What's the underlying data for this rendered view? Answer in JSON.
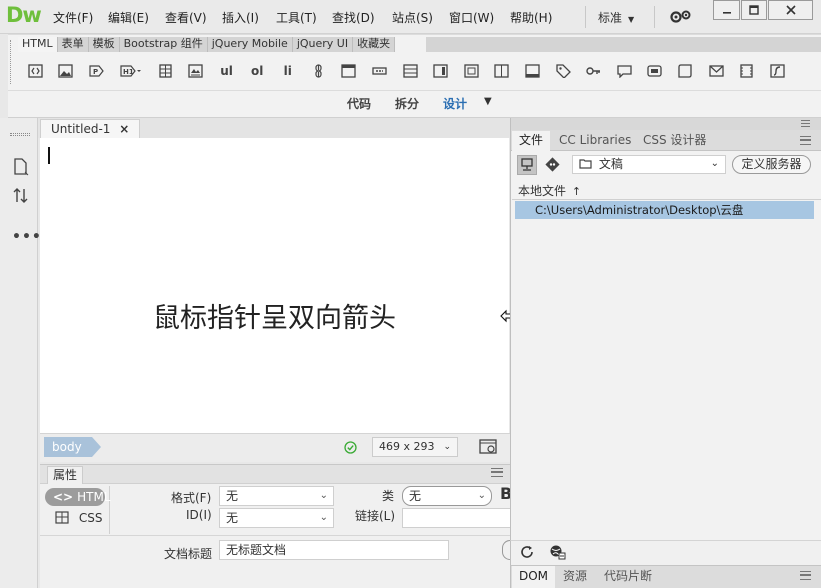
{
  "app": {
    "logo": "Dw",
    "menus": [
      "文件(F)",
      "编辑(E)",
      "查看(V)",
      "插入(I)",
      "工具(T)",
      "查找(D)",
      "站点(S)",
      "窗口(W)",
      "帮助(H)"
    ],
    "workspace": "标准",
    "window_buttons": [
      "minimize",
      "maximize",
      "close"
    ]
  },
  "insert_panel": {
    "tabs": [
      "HTML",
      "表单",
      "模板",
      "Bootstrap 组件",
      "jQuery Mobile",
      "jQuery UI",
      "收藏夹"
    ],
    "active_tab": "HTML",
    "text_buttons": {
      "ul": "ul",
      "ol": "ol",
      "li": "li"
    }
  },
  "view_modes": {
    "code": "代码",
    "split": "拆分",
    "design": "设计",
    "active": "设计"
  },
  "document": {
    "tab_title": "Untitled-1",
    "tab_close": "×",
    "overlay_caption": "鼠标指针呈双向箭头"
  },
  "status_bar": {
    "tag": "body",
    "size": "469 x 293"
  },
  "properties": {
    "title": "属性",
    "html_button": "HTML",
    "css_button": "CSS",
    "format_label": "格式(F)",
    "format_value": "无",
    "id_label": "ID(I)",
    "id_value": "无",
    "class_label": "类",
    "class_value": "无",
    "link_label": "链接(L)",
    "link_value": "",
    "bold_glyph": "B",
    "doc_title_label": "文档标题",
    "doc_title_value": "无标题文档"
  },
  "files_panel": {
    "tabs": [
      "文件",
      "CC Libraries",
      "CSS 设计器"
    ],
    "active_tab": "文件",
    "site": "文稿",
    "define_server": "定义服务器",
    "local_files_header": "本地文件",
    "local_path": "C:\\Users\\Administrator\\Desktop\\云盘",
    "bottom_tabs": [
      "DOM",
      "资源",
      "代码片断"
    ],
    "active_bottom_tab": "DOM"
  },
  "colors": {
    "logo": "#6fbf3c",
    "active_view": "#2a6eb2",
    "selected_row": "#a7c6e2",
    "status_ok": "#3aaa35"
  }
}
